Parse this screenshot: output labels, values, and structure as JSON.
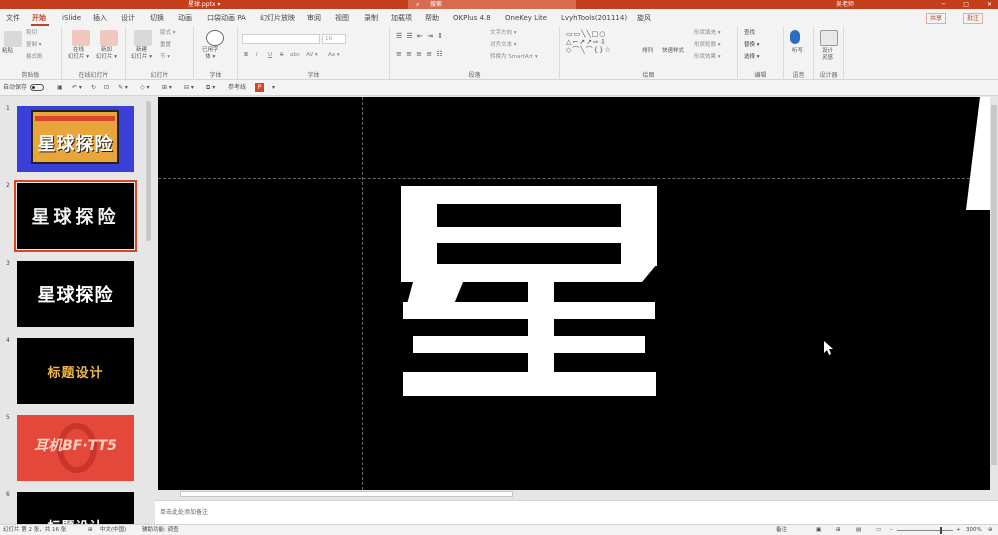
{
  "titlebar": {
    "doc_title": "星球.pptx ▾",
    "search_placeholder": "搜索",
    "user_name": "吴老师",
    "min_glyph": "─",
    "max_glyph": "□",
    "close_glyph": "✕"
  },
  "tabs": [
    {
      "label": "文件",
      "active": false
    },
    {
      "label": "开始",
      "active": true
    },
    {
      "label": "iSlide",
      "active": false
    },
    {
      "label": "插入",
      "active": false
    },
    {
      "label": "设计",
      "active": false
    },
    {
      "label": "切换",
      "active": false
    },
    {
      "label": "动画",
      "active": false
    },
    {
      "label": "口袋动画 PA",
      "active": false
    },
    {
      "label": "幻灯片放映",
      "active": false
    },
    {
      "label": "审阅",
      "active": false
    },
    {
      "label": "视图",
      "active": false
    },
    {
      "label": "录制",
      "active": false
    },
    {
      "label": "加载项",
      "active": false
    },
    {
      "label": "帮助",
      "active": false
    },
    {
      "label": "OKPlus 4.8",
      "active": false
    },
    {
      "label": "OneKey Lite",
      "active": false
    },
    {
      "label": "LvyhTools(201114)",
      "active": false
    },
    {
      "label": "旋风",
      "active": false
    }
  ],
  "share_label": "共享",
  "comment_label": "批注",
  "ribbon": {
    "clipboard": {
      "paste": "粘贴",
      "cut": "剪切",
      "copy": "复制 ▾",
      "format": "格式刷",
      "label": "剪贴板"
    },
    "online": {
      "btn1": "在线\n幻灯片 ▾",
      "btn2": "新加\n幻灯片 ▾",
      "label": "在线幻灯片"
    },
    "slides": {
      "new": "新建\n幻灯片 ▾",
      "layout": "版式 ▾",
      "reset": "重置",
      "section": "节 ▾",
      "label": "幻灯片"
    },
    "font_styles": {
      "btn": "已用字\n体 ▾",
      "label": "字体"
    },
    "font": {
      "name_box": "",
      "size_box": "10",
      "bold": "B",
      "italic": "I",
      "underline": "U",
      "strike": "S",
      "shadow": "abc",
      "spacing": "AV ▾",
      "case": "Aa ▾",
      "label": "字体"
    },
    "paragraph": {
      "direction": "文字方向 ▾",
      "align": "对齐文本 ▾",
      "smartart": "转换为 SmartArt ▾",
      "label": "段落"
    },
    "drawing": {
      "arrange": "排列",
      "quick": "快速样式",
      "fill": "形状填充 ▾",
      "outline": "形状轮廓 ▾",
      "effect": "形状效果 ▾",
      "label": "绘图"
    },
    "editing": {
      "find": "查找",
      "replace": "替换 ▾",
      "select": "选择 ▾",
      "label": "编辑"
    },
    "voice": {
      "dictate": "听写",
      "label": "语音"
    },
    "designer": {
      "btn": "设计\n灵感",
      "label": "设计器"
    }
  },
  "qat": {
    "autosave": "自动保存",
    "ref": "参考线"
  },
  "slides": [
    {
      "num": "1",
      "title": "星球探险",
      "bg": "#3a3fd8",
      "fg": "#ffffff"
    },
    {
      "num": "2",
      "title": "星球探险",
      "bg": "#000000",
      "fg": "#ffffff"
    },
    {
      "num": "3",
      "title": "星球探险",
      "bg": "#000000",
      "fg": "#ffffff"
    },
    {
      "num": "4",
      "title": "标题设计",
      "bg": "#000000",
      "fg": "#f2b84b"
    },
    {
      "num": "5",
      "title": "耳机BF·TT5",
      "bg": "#e4483a",
      "fg": "#ffb4a0"
    },
    {
      "num": "6",
      "title": "标题设计",
      "bg": "#000000",
      "fg": "#ffffff"
    }
  ],
  "canvas": {
    "big_char": "星"
  },
  "notes_placeholder": "单击此处添加备注",
  "status": {
    "slide_count": "幻灯片 第 2 张，共 16 张",
    "lang": "中文(中国)",
    "accessibility": "辅助功能: 调查",
    "notes": "备注",
    "zoom": "300%"
  },
  "colors": {
    "accent": "#c43e1c",
    "canvas_bg": "#000000",
    "glyph": "#ffffff"
  }
}
